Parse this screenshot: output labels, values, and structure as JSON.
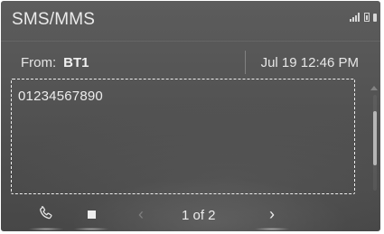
{
  "header": {
    "title": "SMS/MMS"
  },
  "message": {
    "from_label": "From:",
    "from_name": "BT1",
    "date": "Jul 19 12:46 PM",
    "body": "01234567890"
  },
  "pager": {
    "current_page": 1,
    "total_pages": 2,
    "label": "1 of 2"
  },
  "icons": {
    "status": [
      "signal-icon",
      "battery-icon",
      "status-indicator-icon"
    ],
    "call": "phone-icon",
    "stop": "stop-icon",
    "prev": "chevron-left-icon",
    "next": "chevron-right-icon"
  },
  "colors": {
    "background": "#555555",
    "text": "#ebebeb",
    "dashed_outline": "#eeeeee"
  }
}
